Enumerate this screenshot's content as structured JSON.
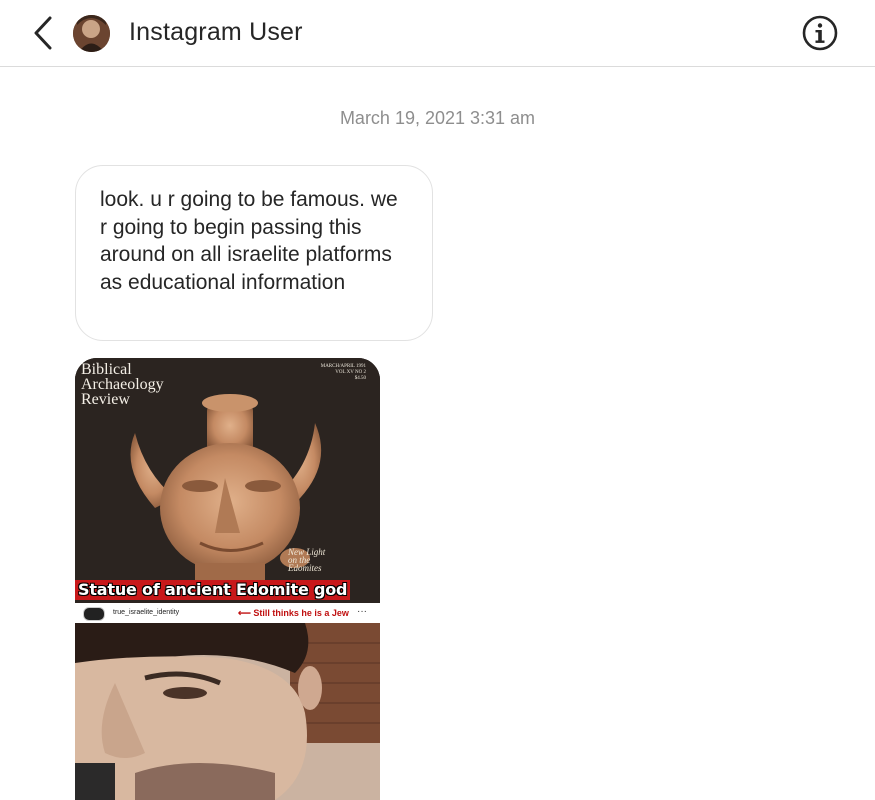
{
  "header": {
    "title": "Instagram User",
    "back_icon": "chevron-left-icon",
    "info_icon": "info-circle-icon"
  },
  "thread": {
    "timestamp": "March 19, 2021 3:31 am",
    "message_text": "look. u r going to be famous. we r going to begin passing this around on all israelite platforms as educational information"
  },
  "media": {
    "magazine_title": "Biblical\nArchaeology\nReview",
    "magazine_date": "MARCH/APRIL 1991\nVOL XV NO 2\n$4.50",
    "magazine_subtitle": "New Light\non the\nEdomites",
    "caption": "Statue of ancient Edomite god",
    "post_username": "true_israelite_identity",
    "post_note": "⟵ Still thinks he is a Jew",
    "post_more": "···"
  },
  "colors": {
    "text": "#262626",
    "muted": "#8e8e8e",
    "border": "#dbdbdb",
    "caption_red": "#c8181a"
  }
}
